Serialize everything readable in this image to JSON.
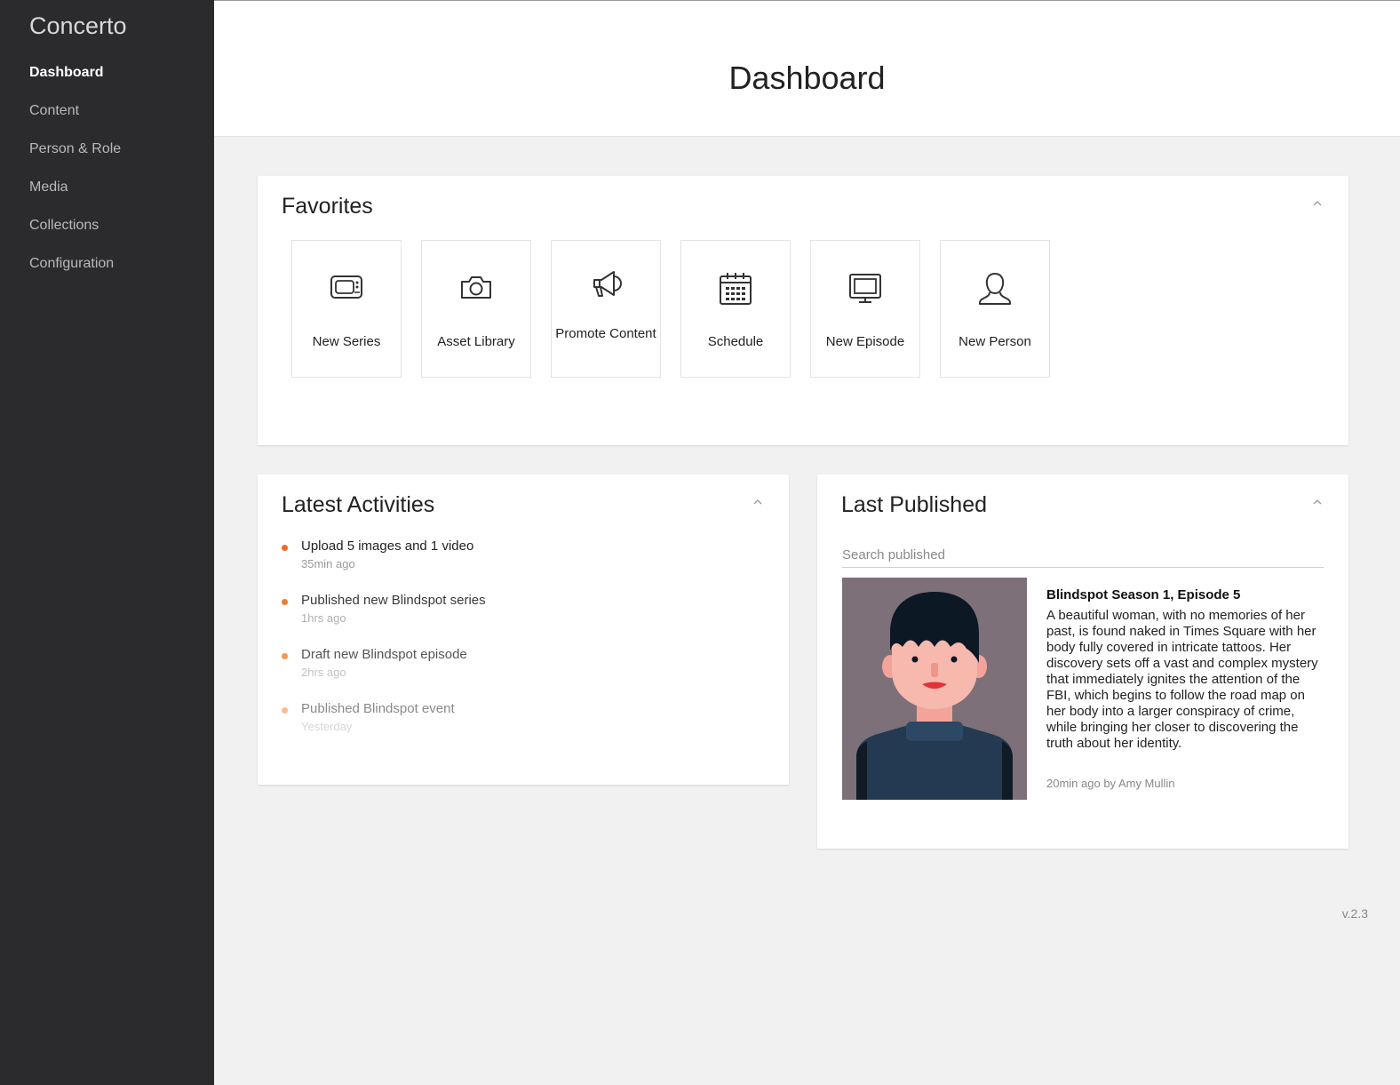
{
  "sidebar": {
    "brand": "Concerto",
    "items": [
      {
        "label": "Dashboard",
        "active": true
      },
      {
        "label": "Content",
        "active": false
      },
      {
        "label": "Person & Role",
        "active": false
      },
      {
        "label": "Media",
        "active": false
      },
      {
        "label": "Collections",
        "active": false
      },
      {
        "label": "Configuration",
        "active": false
      }
    ]
  },
  "header": {
    "title": "Dashboard"
  },
  "favorites": {
    "title": "Favorites",
    "tiles": [
      {
        "label": "New Series",
        "icon": "tv-icon"
      },
      {
        "label": "Asset Library",
        "icon": "camera-icon"
      },
      {
        "label": "Promote Content",
        "icon": "megaphone-icon"
      },
      {
        "label": "Schedule",
        "icon": "calendar-icon"
      },
      {
        "label": "New Episode",
        "icon": "monitor-icon"
      },
      {
        "label": "New Person",
        "icon": "person-icon"
      }
    ]
  },
  "activities": {
    "title": "Latest Activities",
    "items": [
      {
        "text": "Upload 5 images and 1 video",
        "time": "35min ago"
      },
      {
        "text": "Published new Blindspot series",
        "time": "1hrs ago"
      },
      {
        "text": "Draft new Blindspot episode",
        "time": "2hrs ago"
      },
      {
        "text": "Published Blindspot event",
        "time": "Yesterday"
      }
    ]
  },
  "last_published": {
    "title": "Last Published",
    "search_placeholder": "Search published",
    "item": {
      "title": "Blindspot Season 1, Episode 5",
      "description": "A beautiful woman, with no memories of her past, is found naked in Times Square with her body fully covered in intricate tattoos. Her discovery sets off a vast and complex mystery that immediately ignites the attention of the FBI, which begins to follow the road map on her body into a larger conspiracy of crime, while bringing her closer to discovering the truth about her identity.",
      "meta": "20min ago by Amy Mullin"
    }
  },
  "footer": {
    "version": "v.2.3"
  },
  "colors": {
    "sidebar_bg": "#2b2b2d",
    "accent": "#f26b1d",
    "page_bg": "#f1f1f1"
  }
}
